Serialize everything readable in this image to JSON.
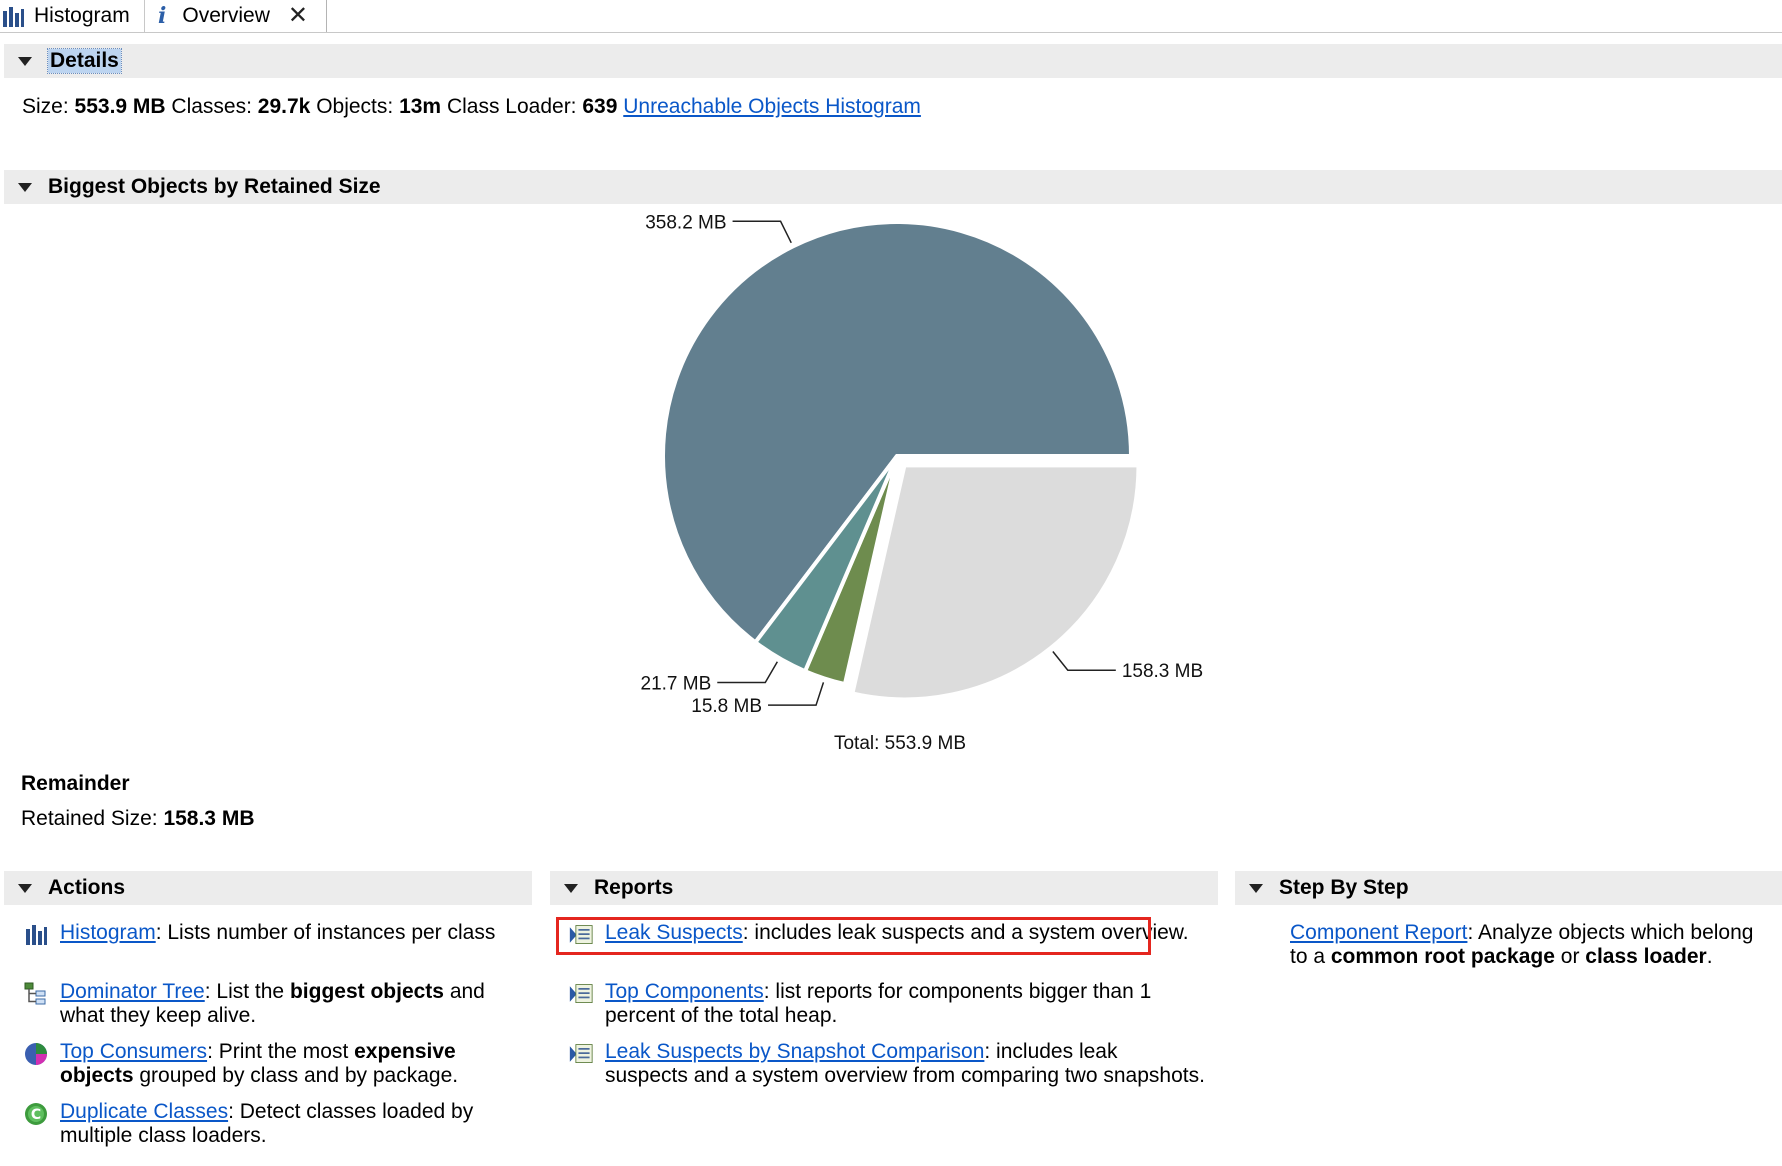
{
  "tabs": [
    {
      "label": "Histogram",
      "icon": "histogram-icon"
    },
    {
      "label": "Overview",
      "icon": "info-icon",
      "active": true,
      "closable": true
    }
  ],
  "details": {
    "title": "Details",
    "size_label": "Size:",
    "size_value": "553.9 MB",
    "classes_label": "Classes:",
    "classes_value": "29.7k",
    "objects_label": "Objects:",
    "objects_value": "13m",
    "classloader_label": "Class Loader:",
    "classloader_value": "639",
    "link": "Unreachable Objects Histogram"
  },
  "biggest": {
    "title": "Biggest Objects by Retained Size",
    "total_label": "Total: 553.9 MB"
  },
  "chart_data": {
    "type": "pie",
    "total": "Total: 553.9 MB",
    "slices": [
      {
        "label": "358.2 MB",
        "value": 358.2,
        "color": "#627f8f",
        "exploded": false
      },
      {
        "label": "158.3 MB",
        "value": 158.3,
        "color": "#dcdcdc",
        "exploded": true
      },
      {
        "label": "15.8 MB",
        "value": 15.8,
        "color": "#6e8c4e",
        "exploded": false
      },
      {
        "label": "21.7 MB",
        "value": 21.7,
        "color": "#5f9090",
        "exploded": false
      }
    ]
  },
  "remainder": {
    "title": "Remainder",
    "retained_label": "Retained Size:",
    "retained_value": "158.3 MB"
  },
  "actions": {
    "title": "Actions",
    "items": [
      {
        "link": "Histogram",
        "text": ": Lists number of instances per class",
        "icon": "histogram-icon"
      },
      {
        "link": "Dominator Tree",
        "pre": ": List the ",
        "bold": "biggest objects",
        "post": " and what they keep alive.",
        "icon": "dominator-tree-icon"
      },
      {
        "link": "Top Consumers",
        "pre": ": Print the most ",
        "bold": "expensive objects",
        "post": " grouped by class and by package.",
        "icon": "top-consumers-icon"
      },
      {
        "link": "Duplicate Classes",
        "text": ": Detect classes loaded by multiple class loaders.",
        "icon": "duplicate-classes-icon"
      }
    ]
  },
  "reports": {
    "title": "Reports",
    "items": [
      {
        "link": "Leak Suspects",
        "text": ": includes leak suspects and a system overview.",
        "icon": "report-icon"
      },
      {
        "link": "Top Components",
        "text": ": list reports for components bigger than 1 percent of the total heap.",
        "icon": "report-icon"
      },
      {
        "link": "Leak Suspects by Snapshot Comparison",
        "text": ": includes leak suspects and a system overview from comparing two snapshots.",
        "icon": "report-icon"
      }
    ]
  },
  "step_by_step": {
    "title": "Step By Step",
    "items": [
      {
        "link": "Component Report",
        "pre": ": Analyze objects which belong to a ",
        "bold1": "common root package",
        "mid": " or ",
        "bold2": "class loader",
        "post": "."
      }
    ]
  }
}
